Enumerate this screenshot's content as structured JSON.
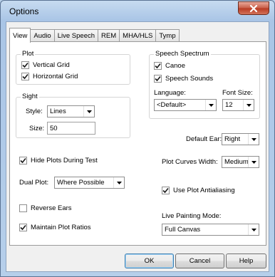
{
  "window": {
    "title": "Options"
  },
  "tabs": [
    "View",
    "Audio",
    "Live Speech",
    "REM",
    "MHA/HLS",
    "Tymp"
  ],
  "plot": {
    "title": "Plot",
    "vertical_grid": {
      "label": "Vertical Grid",
      "checked": true
    },
    "horizontal_grid": {
      "label": "Horizontal Grid",
      "checked": true
    }
  },
  "sight": {
    "title": "Sight",
    "style_label": "Style:",
    "style_value": "Lines",
    "size_label": "Size:",
    "size_value": "50"
  },
  "speech_spectrum": {
    "title": "Speech Spectrum",
    "canoe": {
      "label": "Canoe",
      "checked": true
    },
    "speech_sounds": {
      "label": "Speech Sounds",
      "checked": true
    },
    "language_label": "Language:",
    "language_value": "<Default>",
    "font_size_label": "Font Size:",
    "font_size_value": "12"
  },
  "default_ear": {
    "label": "Default Ear:",
    "value": "Right"
  },
  "hide_plots": {
    "label": "Hide Plots During Test",
    "checked": true
  },
  "plot_curves_width": {
    "label": "Plot Curves Width:",
    "value": "Medium"
  },
  "dual_plot": {
    "label": "Dual Plot:",
    "value": "Where Possible"
  },
  "use_antialiasing": {
    "label": "Use Plot Antialiasing",
    "checked": true
  },
  "reverse_ears": {
    "label": "Reverse Ears",
    "checked": false
  },
  "live_painting": {
    "label": "Live Painting Mode:",
    "value": "Full Canvas"
  },
  "maintain_ratios": {
    "label": "Maintain Plot Ratios",
    "checked": true
  },
  "buttons": {
    "ok": "OK",
    "cancel": "Cancel",
    "help": "Help"
  }
}
